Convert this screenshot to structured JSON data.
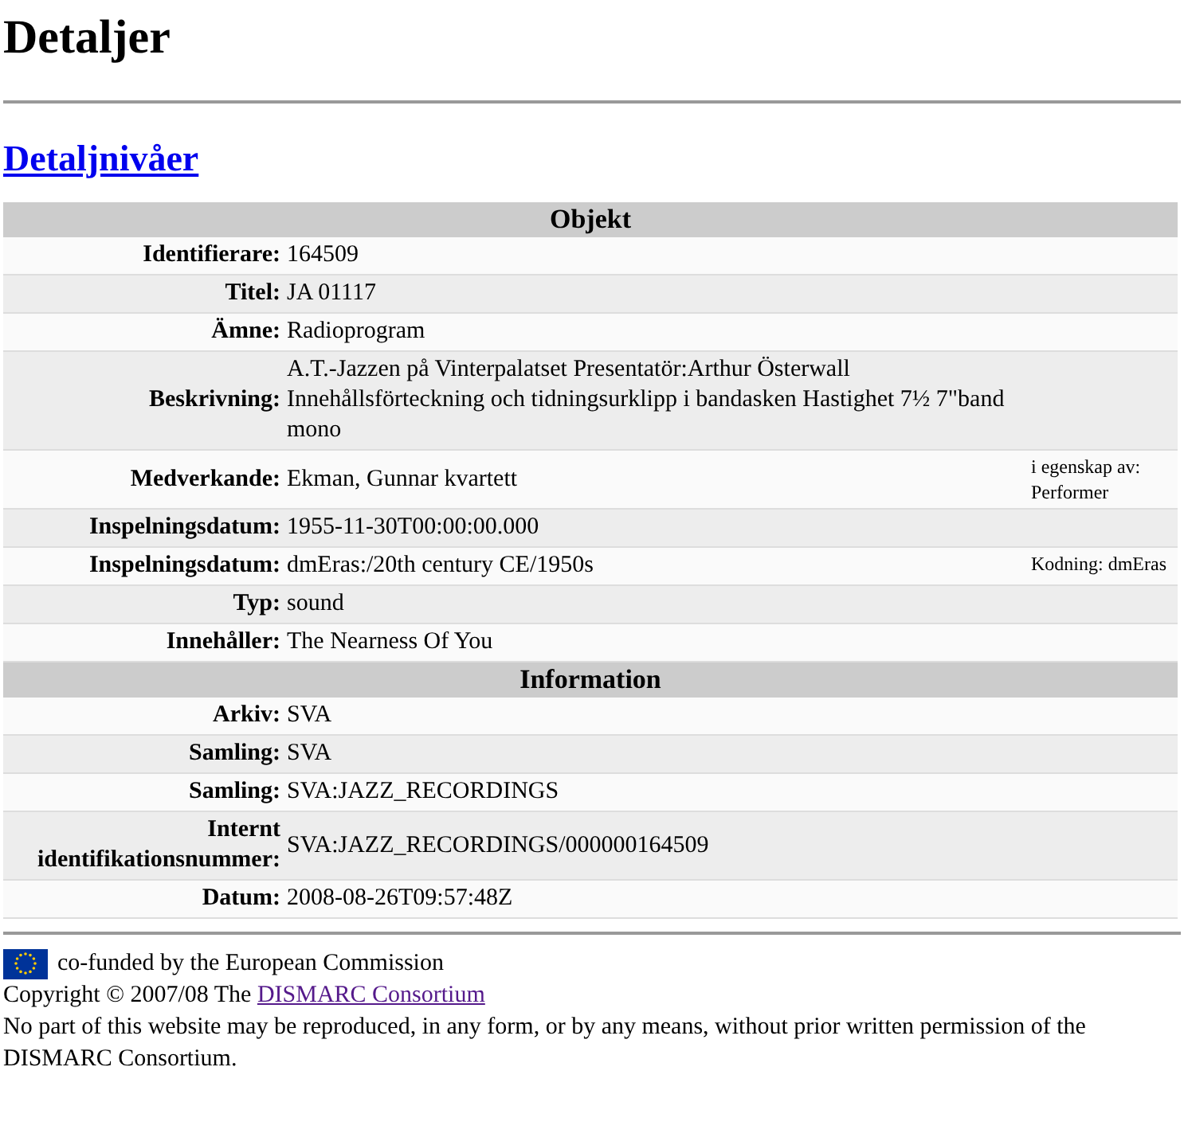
{
  "title": "Detaljer",
  "section_link": "Detaljnivåer",
  "sections": [
    {
      "heading": "Objekt",
      "rows": [
        {
          "label": "Identifierare:",
          "value": "164509"
        },
        {
          "label": "Titel:",
          "value": "JA 01117"
        },
        {
          "label": "Ämne:",
          "value": "Radioprogram"
        },
        {
          "label": "Beskrivning:",
          "value": "A.T.-Jazzen på Vinterpalatset Presentatör:Arthur Österwall Innehållsförteckning och tidningsurklipp i bandasken Hastighet 7½ 7\"band mono"
        },
        {
          "label": "Medverkande:",
          "value": "Ekman, Gunnar kvartett",
          "note": "i egenskap av: Performer"
        },
        {
          "label": "Inspelningsdatum:",
          "value": "1955-11-30T00:00:00.000"
        },
        {
          "label": "Inspelningsdatum:",
          "value": "dmEras:/20th century CE/1950s",
          "note": "Kodning: dmEras"
        },
        {
          "label": "Typ:",
          "value": "sound"
        },
        {
          "label": "Innehåller:",
          "value": "The Nearness Of You"
        }
      ]
    },
    {
      "heading": "Information",
      "rows": [
        {
          "label": "Arkiv:",
          "value": "SVA"
        },
        {
          "label": "Samling:",
          "value": "SVA"
        },
        {
          "label": "Samling:",
          "value": "SVA:JAZZ_RECORDINGS"
        },
        {
          "label": "Internt identifikationsnummer:",
          "value": "SVA:JAZZ_RECORDINGS/000000164509"
        },
        {
          "label": "Datum:",
          "value": "2008-08-26T09:57:48Z"
        }
      ]
    }
  ],
  "footer": {
    "funding": "co-funded by the European Commission",
    "copyright": "Copyright © 2007/08 The",
    "copyright_link": "DISMARC Consortium",
    "notice": "No part of this website may be reproduced, in any form, or by any means, without prior written permission of the DISMARC Consortium."
  }
}
